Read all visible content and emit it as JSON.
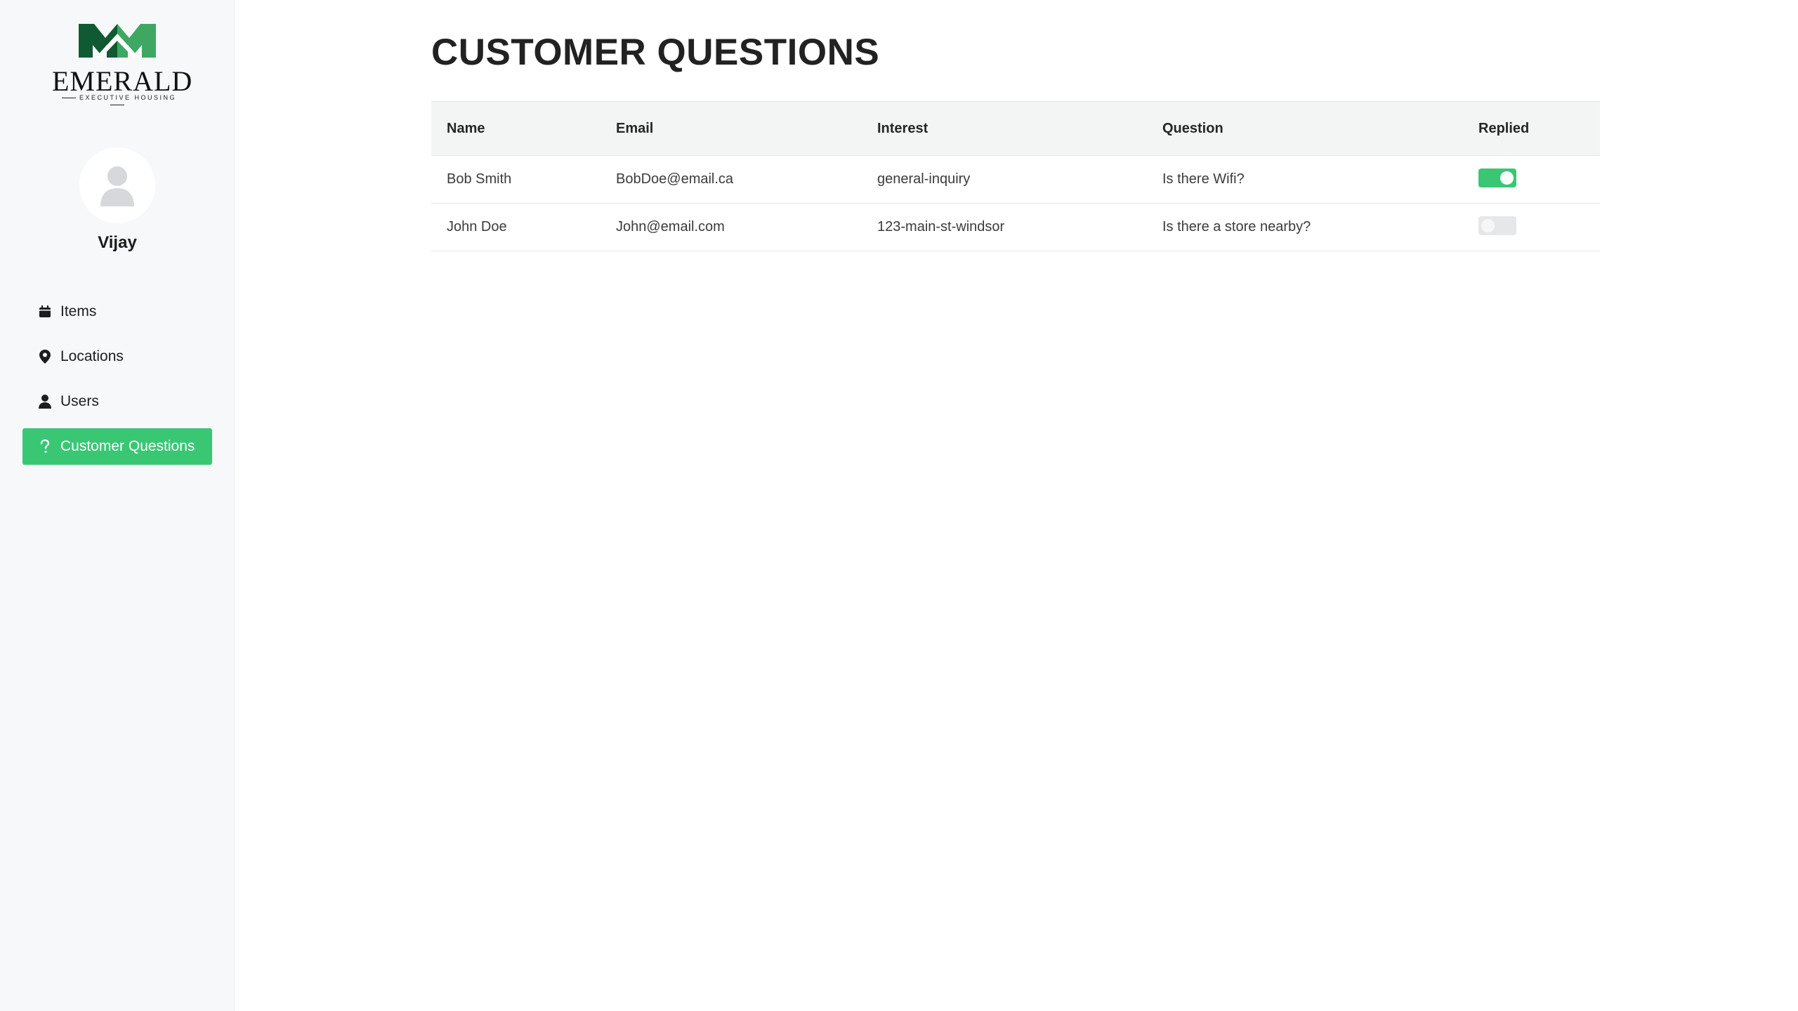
{
  "brand": {
    "name": "EMERALD",
    "tagline": "EXECUTIVE HOUSING",
    "accent": "#3ac774",
    "logo_dark": "#0f5a32",
    "logo_light": "#3ea862"
  },
  "user": {
    "name": "Vijay"
  },
  "sidebar": {
    "items": [
      {
        "label": "Items",
        "icon": "calendar-icon",
        "active": false
      },
      {
        "label": "Locations",
        "icon": "map-pin-icon",
        "active": false
      },
      {
        "label": "Users",
        "icon": "user-icon",
        "active": false
      },
      {
        "label": "Customer Questions",
        "icon": "question-icon",
        "active": true
      }
    ]
  },
  "page": {
    "title": "CUSTOMER QUESTIONS"
  },
  "table": {
    "columns": [
      "Name",
      "Email",
      "Interest",
      "Question",
      "Replied"
    ],
    "rows": [
      {
        "name": "Bob Smith",
        "email": "BobDoe@email.ca",
        "interest": "general-inquiry",
        "question": "Is there Wifi?",
        "replied": true
      },
      {
        "name": "John Doe",
        "email": "John@email.com",
        "interest": "123-main-st-windsor",
        "question": "Is there a store nearby?",
        "replied": false
      }
    ]
  }
}
